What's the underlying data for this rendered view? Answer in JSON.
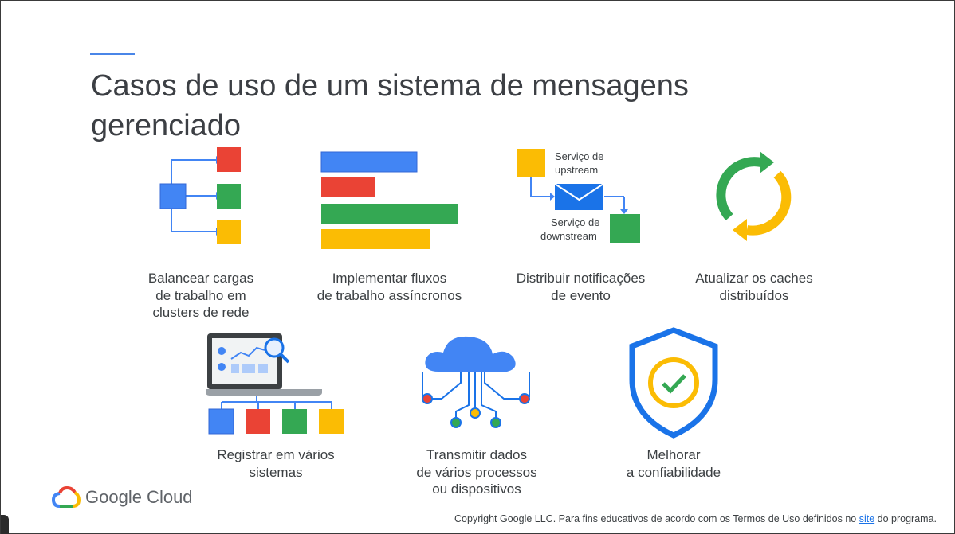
{
  "slide": {
    "title_line1": "Casos de uso de um sistema de mensagens",
    "title_line2": "gerenciado",
    "colors": {
      "blue": "#4285f4",
      "red": "#ea4335",
      "green": "#34a853",
      "yellow": "#fbbc04",
      "accent": "#4a86e8"
    }
  },
  "use_cases": [
    {
      "icon": "load-balancing-icon",
      "lines": [
        "Balancear cargas",
        "de trabalho em",
        "clusters de rede"
      ]
    },
    {
      "icon": "async-bars-icon",
      "lines": [
        "Implementar fluxos",
        "de trabalho assíncronos"
      ]
    },
    {
      "icon": "notification-flow-icon",
      "lines": [
        "Distribuir notificações",
        "de evento"
      ]
    },
    {
      "icon": "refresh-cycle-icon",
      "lines": [
        "Atualizar os caches",
        "distribuídos"
      ]
    },
    {
      "icon": "laptop-logging-icon",
      "lines": [
        "Registrar em vários",
        "sistemas"
      ]
    },
    {
      "icon": "cloud-network-icon",
      "lines": [
        "Transmitir dados",
        "de vários processos",
        "ou dispositivos"
      ]
    },
    {
      "icon": "shield-check-icon",
      "lines": [
        "Melhorar",
        "a confiabilidade"
      ]
    }
  ],
  "diagram_labels": {
    "upstream_line1": "Serviço de",
    "upstream_line2": "upstream",
    "downstream_line1": "Serviço de",
    "downstream_line2": "downstream"
  },
  "brand": {
    "name": "Google Cloud"
  },
  "footer": {
    "text_before": "Copyright Google LLC. Para fins educativos de acordo com os Termos de Uso definidos no ",
    "link": "site",
    "text_after": " do programa."
  }
}
